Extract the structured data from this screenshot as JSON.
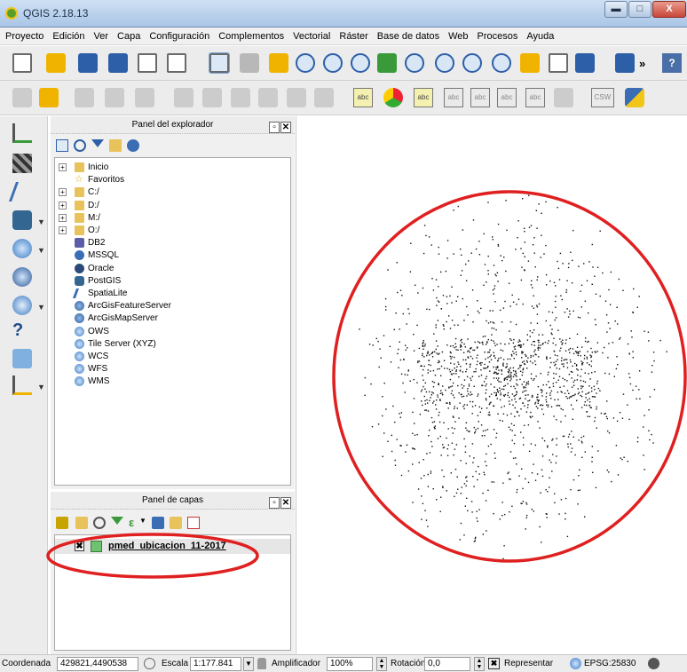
{
  "window": {
    "title": "QGIS 2.18.13",
    "controls": {
      "minimize": "▬",
      "maximize": "□",
      "close": "X"
    }
  },
  "menubar": [
    "Proyecto",
    "Edición",
    "Ver",
    "Capa",
    "Configuración",
    "Complementos",
    "Vectorial",
    "Ráster",
    "Base de datos",
    "Web",
    "Procesos",
    "Ayuda"
  ],
  "toolbar2": {
    "labels": [
      "abc",
      "abc",
      "abc",
      "abc",
      "abc",
      "abc",
      "CSW"
    ]
  },
  "toolbar1": {
    "overflow": "»",
    "help": "?"
  },
  "browser_panel": {
    "title": "Panel del explorador",
    "items": [
      {
        "label": "Inicio",
        "icon": "folder-icon",
        "expandable": true
      },
      {
        "label": "Favoritos",
        "icon": "star-icon",
        "expandable": false
      },
      {
        "label": "C:/",
        "icon": "folder-icon",
        "expandable": true
      },
      {
        "label": "D:/",
        "icon": "folder-icon",
        "expandable": true
      },
      {
        "label": "M:/",
        "icon": "folder-icon",
        "expandable": true
      },
      {
        "label": "O:/",
        "icon": "folder-icon",
        "expandable": true
      },
      {
        "label": "DB2",
        "icon": "db2-icon",
        "expandable": false
      },
      {
        "label": "MSSQL",
        "icon": "mssql-icon",
        "expandable": false
      },
      {
        "label": "Oracle",
        "icon": "oracle-icon",
        "expandable": false
      },
      {
        "label": "PostGIS",
        "icon": "postgis-icon",
        "expandable": false
      },
      {
        "label": "SpatiaLite",
        "icon": "spatialite-icon",
        "expandable": false
      },
      {
        "label": "ArcGisFeatureServer",
        "icon": "arcgis-icon",
        "expandable": false
      },
      {
        "label": "ArcGisMapServer",
        "icon": "arcgis-icon",
        "expandable": false
      },
      {
        "label": "OWS",
        "icon": "ows-icon",
        "expandable": false
      },
      {
        "label": "Tile Server (XYZ)",
        "icon": "xyz-icon",
        "expandable": false
      },
      {
        "label": "WCS",
        "icon": "wcs-icon",
        "expandable": false
      },
      {
        "label": "WFS",
        "icon": "wfs-icon",
        "expandable": false
      },
      {
        "label": "WMS",
        "icon": "wms-icon",
        "expandable": false
      }
    ]
  },
  "layers_panel": {
    "title": "Panel de capas",
    "layer": {
      "name": "pmed_ubicacion_11-2017",
      "visible_mark": "✖",
      "color": "#6dc36f"
    }
  },
  "statusbar": {
    "coord_label": "Coordenada",
    "coord_value": "429821,4490538",
    "scale_label": "Escala",
    "scale_value": "1:177.841",
    "magnifier_label": "Amplificador",
    "magnifier_value": "100%",
    "rotation_label": "Rotación",
    "rotation_value": "0,0",
    "render_mark": "✖",
    "render_label": "Representar",
    "crs": "EPSG:25830"
  },
  "colors": {
    "annotation": "#e02020",
    "accent": "#2d5fa8"
  }
}
